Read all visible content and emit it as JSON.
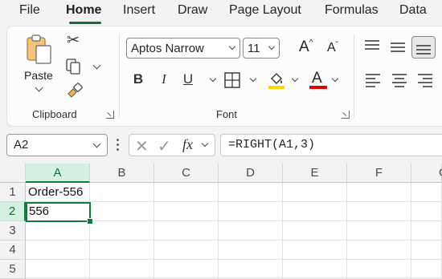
{
  "menu": {
    "tabs": [
      "File",
      "Home",
      "Insert",
      "Draw",
      "Page Layout",
      "Formulas",
      "Data"
    ],
    "active": "Home"
  },
  "clipboard": {
    "paste_label": "Paste",
    "group_label": "Clipboard"
  },
  "font": {
    "name": "Aptos Narrow",
    "size": "11",
    "group_label": "Font",
    "bold": "B",
    "italic": "I",
    "underline": "U",
    "grow": "A",
    "shrink": "A",
    "font_color_letter": "A",
    "fill_color": "#ffd400",
    "text_color": "#e00000"
  },
  "formula_bar": {
    "name_box": "A2",
    "fx": "fx",
    "formula": "=RIGHT(A1,3)"
  },
  "grid": {
    "columns": [
      "A",
      "B",
      "C",
      "D",
      "E",
      "F",
      "G"
    ],
    "rows": [
      "1",
      "2",
      "3",
      "4",
      "5"
    ],
    "cells": {
      "A1": "Order-556",
      "A2": "556"
    },
    "active_cell": "A2"
  },
  "colors": {
    "accent": "#107c41"
  }
}
